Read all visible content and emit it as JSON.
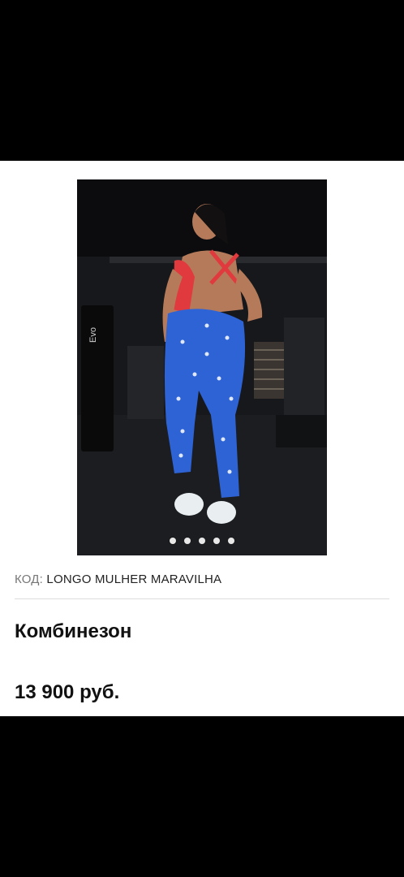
{
  "product": {
    "code_label": "КОД:",
    "code_value": "LONGO MULHER MARAVILHA",
    "title": "Комбинезон",
    "price": "13 900 руб."
  },
  "gallery": {
    "image_count": 5,
    "active_index": 0,
    "brand_sign": "Evo"
  },
  "colors": {
    "leggings": "#2e63d6",
    "top": "#e03a3e",
    "page": "#ffffff",
    "outer": "#000000"
  }
}
